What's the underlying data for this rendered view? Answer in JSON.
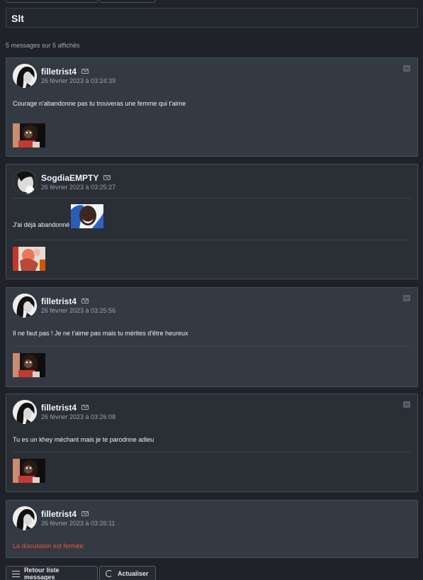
{
  "topic": {
    "title": "Slt"
  },
  "count_text": "5 messages sur 5 affichés",
  "messages": [
    {
      "author": "filletrist4",
      "date": "26 février 2023 à 03:24:39",
      "text": "Courage n'abandonne pas tu trouveras une femme qui t'aime"
    },
    {
      "author": "SogdiaEMPTY",
      "date": "26 février 2023 à 03:25:27",
      "text": "J'ai déjà abandonné"
    },
    {
      "author": "filletrist4",
      "date": "26 février 2023 à 03:25:56",
      "text": "Il ne faut pas ! Je ne t'aime pas mais tu mérites d'être heureux"
    },
    {
      "author": "filletrist4",
      "date": "26 février 2023 à 03:26:08",
      "text": "Tu es un khey méchant mais je te parodnne adieu"
    },
    {
      "author": "filletrist4",
      "date": "26 février 2023 à 03:26:11",
      "text": "La discussion est fermée."
    }
  ],
  "buttons": {
    "back": "Retour liste messages",
    "refresh": "Actualiser"
  },
  "colors": {
    "closed_notice": "#e8573a",
    "background": "#1f2329",
    "card": "#343a43"
  },
  "icons": [
    "mail-icon",
    "quote-icon",
    "list-icon",
    "refresh-icon"
  ]
}
